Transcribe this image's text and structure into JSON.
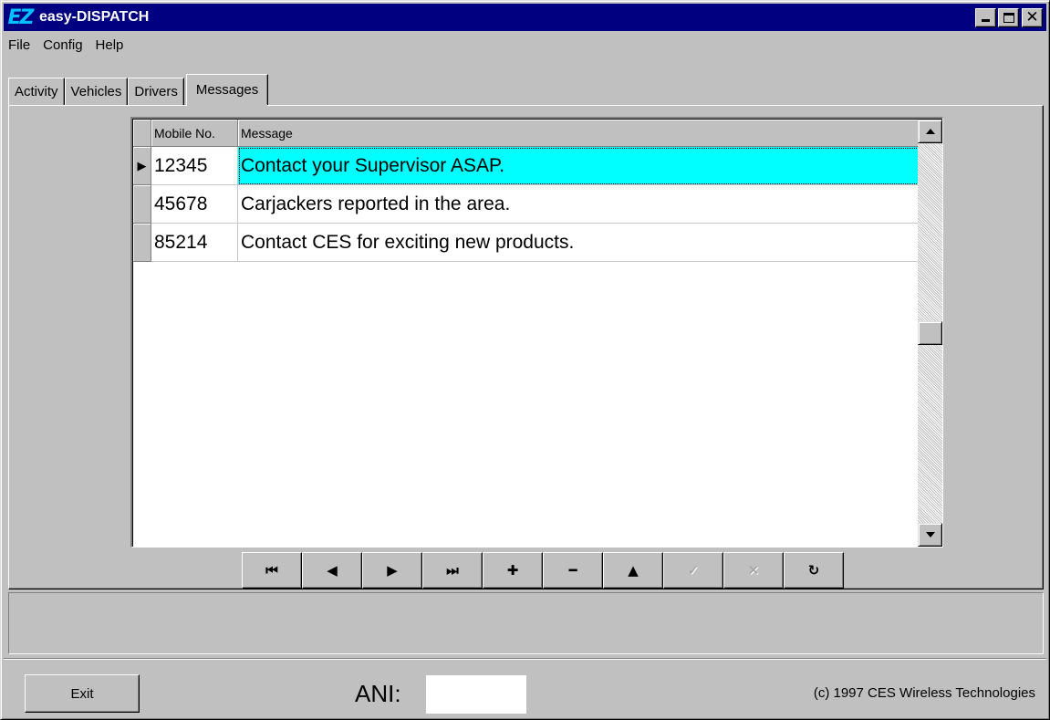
{
  "window": {
    "icon_text": "EZ",
    "title": "easy-DISPATCH",
    "buttons": {
      "minimize": "",
      "maximize": "",
      "close": "✕"
    }
  },
  "menu": [
    "File",
    "Config",
    "Help"
  ],
  "tabs": [
    "Activity",
    "Vehicles",
    "Drivers",
    "Messages"
  ],
  "active_tab": "Messages",
  "grid": {
    "columns": [
      "Mobile No.",
      "Message"
    ],
    "rows": [
      {
        "indicator": "▶",
        "mobile": "12345",
        "message": "Contact your Supervisor ASAP.",
        "selected": true
      },
      {
        "indicator": "",
        "mobile": "45678",
        "message": "Carjackers reported in the area.",
        "selected": false
      },
      {
        "indicator": "",
        "mobile": "85214",
        "message": "Contact CES for exciting new products.",
        "selected": false
      }
    ],
    "selection_color": "#00ffff"
  },
  "navigator": [
    {
      "name": "first-button",
      "glyph": "⏮",
      "enabled": true
    },
    {
      "name": "prior-button",
      "glyph": "◀",
      "enabled": true
    },
    {
      "name": "next-button",
      "glyph": "▶",
      "enabled": true
    },
    {
      "name": "last-button",
      "glyph": "⏭",
      "enabled": true
    },
    {
      "name": "insert-button",
      "glyph": "✚",
      "enabled": true
    },
    {
      "name": "delete-button",
      "glyph": "━",
      "enabled": true
    },
    {
      "name": "edit-button",
      "glyph": "▲",
      "enabled": true
    },
    {
      "name": "post-button",
      "glyph": "✓",
      "enabled": false
    },
    {
      "name": "cancel-button",
      "glyph": "✕",
      "enabled": false
    },
    {
      "name": "refresh-button",
      "glyph": "↻",
      "enabled": true
    }
  ],
  "footer": {
    "exit_label": "Exit",
    "ani_label": "ANI:",
    "ani_value": "",
    "copyright": "(c) 1997 CES Wireless Technologies"
  },
  "colors": {
    "titlebar": "#000080",
    "face": "#c0c0c0",
    "selection": "#00ffff"
  }
}
